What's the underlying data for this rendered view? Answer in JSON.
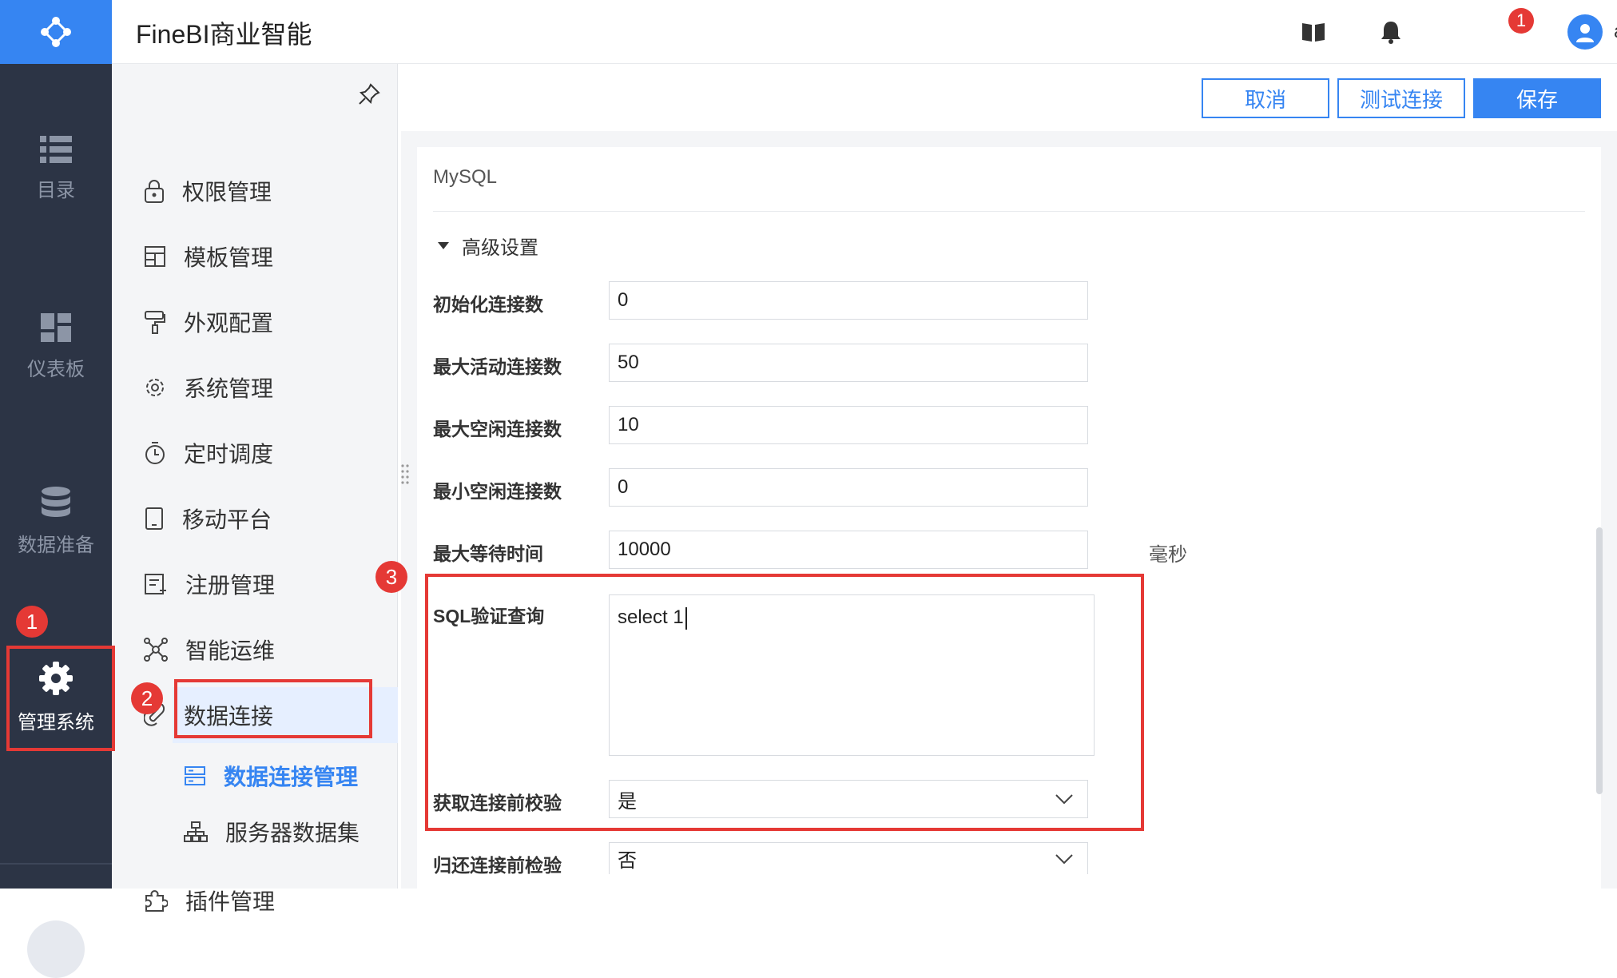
{
  "app": {
    "title": "FineBI商业智能"
  },
  "header": {
    "notification_count": "1",
    "user_name": "admin"
  },
  "rail": {
    "items": [
      {
        "label": "目录",
        "icon": "list-icon"
      },
      {
        "label": "仪表板",
        "icon": "dashboard-icon"
      },
      {
        "label": "数据准备",
        "icon": "database-icon"
      },
      {
        "label": "管理系统",
        "icon": "gear-icon"
      }
    ]
  },
  "subnav": {
    "items": [
      {
        "label": "权限管理",
        "icon": "lock-icon"
      },
      {
        "label": "模板管理",
        "icon": "template-icon"
      },
      {
        "label": "外观配置",
        "icon": "paint-roller-icon"
      },
      {
        "label": "系统管理",
        "icon": "gear-icon"
      },
      {
        "label": "定时调度",
        "icon": "timer-icon"
      },
      {
        "label": "移动平台",
        "icon": "tablet-icon"
      },
      {
        "label": "注册管理",
        "icon": "register-icon"
      },
      {
        "label": "智能运维",
        "icon": "network-icon"
      },
      {
        "label": "数据连接",
        "icon": "link-icon"
      },
      {
        "label": "数据连接管理",
        "icon": "server-icon"
      },
      {
        "label": "服务器数据集",
        "icon": "sitemap-icon"
      },
      {
        "label": "插件管理",
        "icon": "puzzle-icon"
      }
    ]
  },
  "toolbar": {
    "cancel_label": "取消",
    "test_label": "测试连接",
    "save_label": "保存"
  },
  "form": {
    "db_type": "MySQL",
    "advanced_label": "高级设置",
    "fields": [
      {
        "label": "初始化连接数",
        "value": "0"
      },
      {
        "label": "最大活动连接数",
        "value": "50"
      },
      {
        "label": "最大空闲连接数",
        "value": "10"
      },
      {
        "label": "最小空闲连接数",
        "value": "0"
      },
      {
        "label": "最大等待时间",
        "value": "10000"
      }
    ],
    "wait_unit": "毫秒",
    "sql_label": "SQL验证查询",
    "sql_value": "select 1",
    "check_before_get_label": "获取连接前校验",
    "check_before_get_value": "是",
    "check_before_return_label": "归还连接前检验",
    "check_before_return_value": "否"
  },
  "annotations": {
    "step1": "1",
    "step2": "2",
    "step3": "3"
  },
  "colors": {
    "accent": "#3685f2",
    "rail": "#2c3445",
    "annotation": "#e53935"
  }
}
